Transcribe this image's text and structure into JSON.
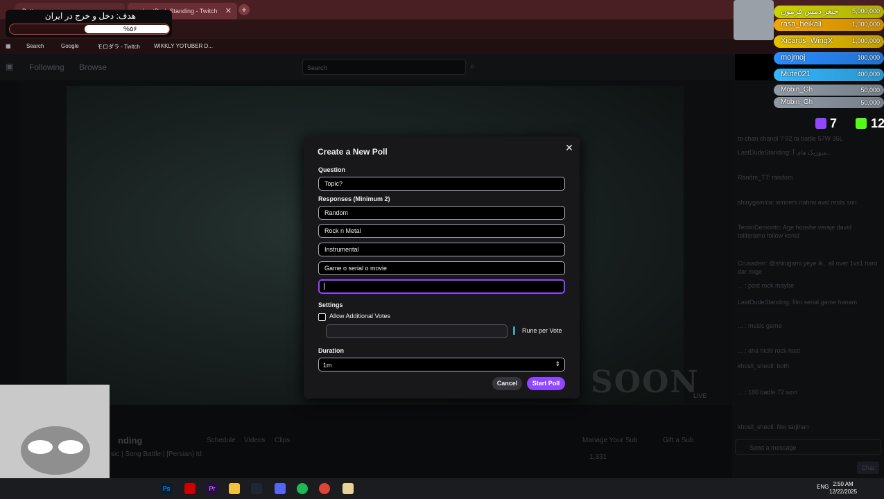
{
  "browser": {
    "tabs": [
      {
        "label": "Batt..."
      },
      {
        "label": "LastDudeStanding - Twitch"
      }
    ],
    "bookmarks": [
      "Search",
      "Google",
      "モロダラ - Twitch",
      "WIKKLY YOTUBER D..."
    ]
  },
  "goal": {
    "title": "هدف: دخل و خرج در ایران",
    "percent": "%۵۶",
    "progress": 0.56
  },
  "twitch": {
    "nav": {
      "following": "Following",
      "browse": "Browse",
      "search_placeholder": "Search"
    },
    "player": {
      "overlay_text": "SOON",
      "live_label": "LIVE"
    },
    "below": {
      "channel": "nding",
      "stream_title": "sic | Song Battle | [Persian] Id",
      "manage_sub": "Manage Your Sub",
      "gift_sub": "Gift a Sub",
      "tabs": [
        "Schedule",
        "Videos",
        "Clips"
      ],
      "viewers": "1,331"
    },
    "chat": {
      "messages": [
        "to chan chandi ? 92 ta battle 57W 35L",
        "LastDudeStanding: میوزیک های آ...",
        "Randm_TT: random",
        "shinygamica: winners nahmi aval resta son",
        "TeminDemonto: Age hooshe veraje david taliteramo follow konid",
        "Crusaderr: @shinigami yeye ik.. all over 1vs1 haro dar mige",
        "... : post rock maybe",
        "LastDudeStanding: film serial game hanam",
        "... : music game",
        "... : aha hichi rock hast",
        "khosll_sheoll: both",
        "... : 180 battle 72 won",
        "khosll_sheoll: film tarjihan"
      ],
      "send_placeholder": "Send a message",
      "chat_button": "Chat"
    }
  },
  "leaderboard": {
    "rows": [
      {
        "name": "جیغر دمس فزمون",
        "value": "5,000,000",
        "color": "#c9d400"
      },
      {
        "name": "rasa_heikali",
        "value": "1,000,000",
        "color": "#f0a800"
      },
      {
        "name": "Xicarus_WingX",
        "value": "1,000,000",
        "color": "#e8c000"
      },
      {
        "name": "mojmoj",
        "value": "100,000",
        "color": "#2a8cff"
      },
      {
        "name": "Mute021",
        "value": "400,000",
        "color": "#35b7ff"
      },
      {
        "name": "Mobin_Gh",
        "value": "50,000",
        "color": "#909aa5"
      },
      {
        "name": "Mobin_Gh",
        "value": "50,000",
        "color": "#909aa5"
      }
    ],
    "twitch_count": "7",
    "kick_count": "12"
  },
  "poll": {
    "title": "Create a New Poll",
    "question_label": "Question",
    "question_value": "Topic?",
    "responses_label": "Responses (Minimum 2)",
    "responses": [
      "Random",
      "Rock n Metal",
      "Instrumental",
      "Game o serial o movie",
      ""
    ],
    "settings_label": "Settings",
    "allow_additional_votes": "Allow Additional Votes",
    "rune_per_vote": "Rune per Vote",
    "duration_label": "Duration",
    "duration_value": "1m",
    "cancel": "Cancel",
    "start": "Start Poll"
  },
  "taskbar": {
    "lang": "ENG",
    "time": "2:50 AM",
    "date": "12/22/2025",
    "apps": [
      "Ps",
      "Pr"
    ]
  },
  "colors": {
    "twitch_purple": "#9147ff",
    "dialog_bg": "#18181b"
  }
}
